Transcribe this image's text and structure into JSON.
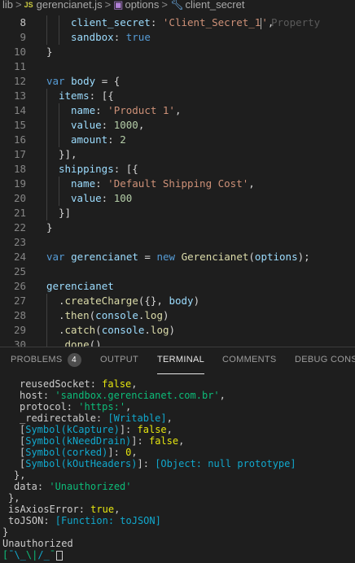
{
  "breadcrumb": {
    "items": [
      "lib",
      "gerencianet.js",
      "options",
      "client_secret"
    ],
    "separator": ">",
    "file_icon_text": "JS"
  },
  "editor": {
    "hint": "Property",
    "lines": [
      {
        "num": "8",
        "indent": 2,
        "segs": [
          [
            "client_secret",
            "p"
          ],
          [
            ": ",
            "pn"
          ],
          [
            "'Client_Secret_1",
            "s"
          ],
          [
            "|CURSOR|",
            "cur"
          ],
          [
            "'",
            "s"
          ],
          [
            ",",
            "pn"
          ]
        ],
        "hint": true,
        "active": true
      },
      {
        "num": "9",
        "indent": 2,
        "segs": [
          [
            "sandbox",
            "p"
          ],
          [
            ": ",
            "pn"
          ],
          [
            "true",
            "k"
          ]
        ]
      },
      {
        "num": "10",
        "indent": 0,
        "segs": [
          [
            "}",
            "pn"
          ]
        ]
      },
      {
        "num": "11",
        "indent": 0,
        "segs": []
      },
      {
        "num": "12",
        "indent": 0,
        "segs": [
          [
            "var ",
            "k"
          ],
          [
            "body",
            "p"
          ],
          [
            " = {",
            "pn"
          ]
        ]
      },
      {
        "num": "13",
        "indent": 1,
        "segs": [
          [
            "items",
            "p"
          ],
          [
            ": [{",
            "pn"
          ]
        ]
      },
      {
        "num": "14",
        "indent": 2,
        "segs": [
          [
            "name",
            "p"
          ],
          [
            ": ",
            "pn"
          ],
          [
            "'Product 1'",
            "s"
          ],
          [
            ",",
            "pn"
          ]
        ]
      },
      {
        "num": "15",
        "indent": 2,
        "segs": [
          [
            "value",
            "p"
          ],
          [
            ": ",
            "pn"
          ],
          [
            "1000",
            "n"
          ],
          [
            ",",
            "pn"
          ]
        ]
      },
      {
        "num": "16",
        "indent": 2,
        "segs": [
          [
            "amount",
            "p"
          ],
          [
            ": ",
            "pn"
          ],
          [
            "2",
            "n"
          ]
        ]
      },
      {
        "num": "17",
        "indent": 1,
        "segs": [
          [
            "}],",
            "pn"
          ]
        ]
      },
      {
        "num": "18",
        "indent": 1,
        "segs": [
          [
            "shippings",
            "p"
          ],
          [
            ": [{",
            "pn"
          ]
        ]
      },
      {
        "num": "19",
        "indent": 2,
        "segs": [
          [
            "name",
            "p"
          ],
          [
            ": ",
            "pn"
          ],
          [
            "'Default Shipping Cost'",
            "s"
          ],
          [
            ",",
            "pn"
          ]
        ]
      },
      {
        "num": "20",
        "indent": 2,
        "segs": [
          [
            "value",
            "p"
          ],
          [
            ": ",
            "pn"
          ],
          [
            "100",
            "n"
          ]
        ]
      },
      {
        "num": "21",
        "indent": 1,
        "segs": [
          [
            "}]",
            "pn"
          ]
        ]
      },
      {
        "num": "22",
        "indent": 0,
        "segs": [
          [
            "}",
            "pn"
          ]
        ]
      },
      {
        "num": "23",
        "indent": 0,
        "segs": []
      },
      {
        "num": "24",
        "indent": 0,
        "segs": [
          [
            "var ",
            "k"
          ],
          [
            "gerencianet",
            "p"
          ],
          [
            " = ",
            "pn"
          ],
          [
            "new ",
            "k"
          ],
          [
            "Gerencianet",
            "f"
          ],
          [
            "(",
            "pn"
          ],
          [
            "options",
            "p"
          ],
          [
            ");",
            "pn"
          ]
        ]
      },
      {
        "num": "25",
        "indent": 0,
        "segs": []
      },
      {
        "num": "26",
        "indent": 0,
        "segs": [
          [
            "gerencianet",
            "p"
          ]
        ]
      },
      {
        "num": "27",
        "indent": 1,
        "segs": [
          [
            ".",
            "pn"
          ],
          [
            "createCharge",
            "f"
          ],
          [
            "({}, ",
            "pn"
          ],
          [
            "body",
            "p"
          ],
          [
            ")",
            "pn"
          ]
        ]
      },
      {
        "num": "28",
        "indent": 1,
        "segs": [
          [
            ".",
            "pn"
          ],
          [
            "then",
            "f"
          ],
          [
            "(",
            "pn"
          ],
          [
            "console",
            "p"
          ],
          [
            ".",
            "pn"
          ],
          [
            "log",
            "f"
          ],
          [
            ")",
            "pn"
          ]
        ]
      },
      {
        "num": "29",
        "indent": 1,
        "segs": [
          [
            ".",
            "pn"
          ],
          [
            "catch",
            "f"
          ],
          [
            "(",
            "pn"
          ],
          [
            "console",
            "p"
          ],
          [
            ".",
            "pn"
          ],
          [
            "log",
            "f"
          ],
          [
            ")",
            "pn"
          ]
        ]
      },
      {
        "num": "30",
        "indent": 1,
        "segs": [
          [
            ".",
            "pn"
          ],
          [
            "done",
            "f"
          ],
          [
            "()",
            "pn"
          ]
        ]
      }
    ]
  },
  "panel": {
    "tabs": [
      {
        "label": "PROBLEMS",
        "badge": "4",
        "active": false
      },
      {
        "label": "OUTPUT",
        "active": false
      },
      {
        "label": "TERMINAL",
        "active": true
      },
      {
        "label": "COMMENTS",
        "active": false
      },
      {
        "label": "DEBUG CONSOLE",
        "active": false
      }
    ]
  },
  "terminal": {
    "lines": [
      {
        "x": 24,
        "segs": [
          [
            "reusedSocket: ",
            ""
          ],
          [
            "false",
            "ty"
          ],
          [
            ",",
            ""
          ]
        ]
      },
      {
        "x": 24,
        "segs": [
          [
            "host: ",
            ""
          ],
          [
            "'sandbox.gerencianet.com.br'",
            "tg"
          ],
          [
            ",",
            ""
          ]
        ]
      },
      {
        "x": 24,
        "segs": [
          [
            "protocol: ",
            ""
          ],
          [
            "'https:'",
            "tg"
          ],
          [
            ",",
            ""
          ]
        ]
      },
      {
        "x": 24,
        "segs": [
          [
            "_redirectable: ",
            ""
          ],
          [
            "[Writable]",
            "tc"
          ],
          [
            ",",
            ""
          ]
        ]
      },
      {
        "x": 24,
        "segs": [
          [
            "[",
            ""
          ],
          [
            "Symbol(kCapture)",
            "tc"
          ],
          [
            "]: ",
            ""
          ],
          [
            "false",
            "ty"
          ],
          [
            ",",
            ""
          ]
        ]
      },
      {
        "x": 24,
        "segs": [
          [
            "[",
            ""
          ],
          [
            "Symbol(kNeedDrain)",
            "tc"
          ],
          [
            "]: ",
            ""
          ],
          [
            "false",
            "ty"
          ],
          [
            ",",
            ""
          ]
        ]
      },
      {
        "x": 24,
        "segs": [
          [
            "[",
            ""
          ],
          [
            "Symbol(corked)",
            "tc"
          ],
          [
            "]: ",
            ""
          ],
          [
            "0",
            "ty"
          ],
          [
            ",",
            ""
          ]
        ]
      },
      {
        "x": 24,
        "segs": [
          [
            "[",
            ""
          ],
          [
            "Symbol(kOutHeaders)",
            "tc"
          ],
          [
            "]: ",
            ""
          ],
          [
            "[Object: null prototype]",
            "tc"
          ]
        ]
      },
      {
        "x": 17,
        "segs": [
          [
            "},",
            ""
          ]
        ]
      },
      {
        "x": 17,
        "segs": [
          [
            "data: ",
            ""
          ],
          [
            "'Unauthorized'",
            "tg"
          ]
        ]
      },
      {
        "x": 10,
        "segs": [
          [
            "},",
            ""
          ]
        ]
      },
      {
        "x": 10,
        "segs": [
          [
            "isAxiosError: ",
            ""
          ],
          [
            "true",
            "ty"
          ],
          [
            ",",
            ""
          ]
        ]
      },
      {
        "x": 10,
        "segs": [
          [
            "toJSON: ",
            ""
          ],
          [
            "[Function: toJSON]",
            "tc"
          ]
        ]
      },
      {
        "x": 3,
        "segs": [
          [
            "}",
            ""
          ]
        ]
      },
      {
        "x": 3,
        "segs": [
          [
            "Unauthorized",
            ""
          ]
        ]
      },
      {
        "x": 3,
        "segs": [
          [
            "[",
            "tg"
          ],
          [
            "¯\\_",
            "tc"
          ],
          [
            "\\|",
            "tg"
          ],
          [
            "/_",
            "tc"
          ],
          [
            "¯",
            "tg"
          ],
          [
            "|CURSOR|",
            "tcur"
          ]
        ]
      }
    ]
  },
  "colors": {
    "background": "#1e1e1e",
    "keyword": "#569cd6",
    "property": "#9cdcfe",
    "string": "#ce9178",
    "number": "#b5cea8",
    "function": "#dcdcaa"
  }
}
